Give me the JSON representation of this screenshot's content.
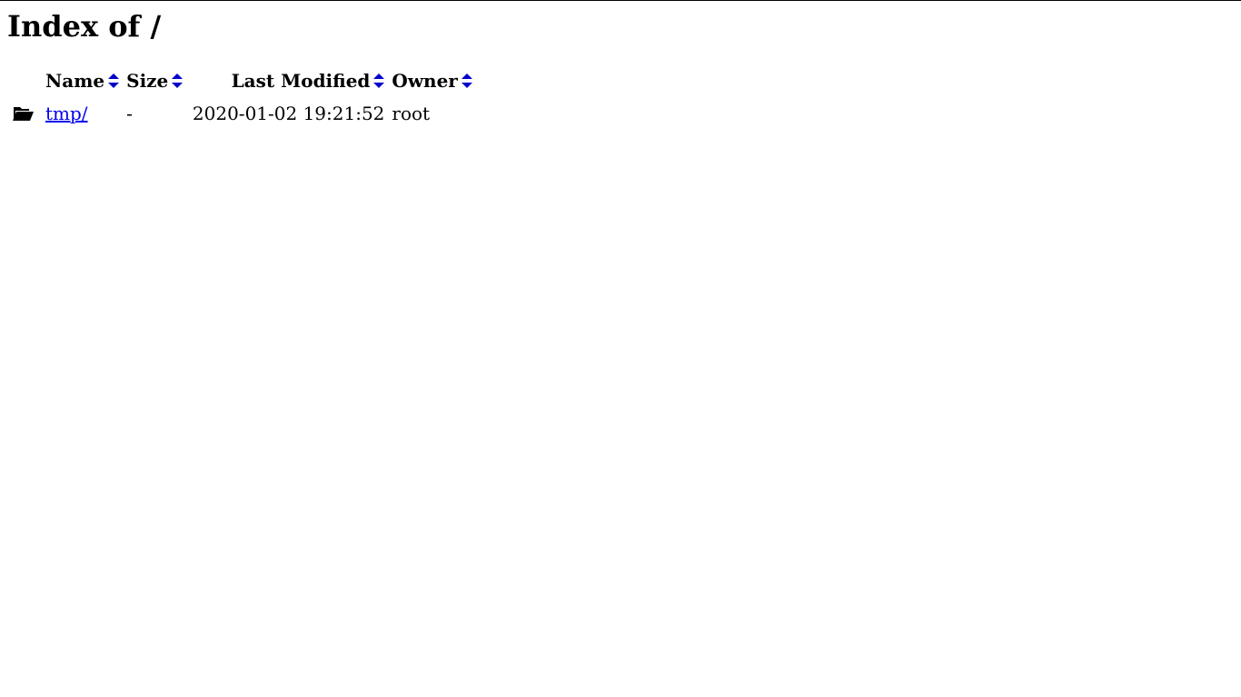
{
  "page": {
    "title": "Index of /"
  },
  "table": {
    "headers": {
      "name": "Name",
      "size": "Size",
      "last_modified": "Last Modified",
      "owner": "Owner"
    },
    "rows": [
      {
        "icon": "folder-open-icon",
        "name": "tmp/",
        "size": "-",
        "last_modified": "2020-01-02 19:21:52",
        "owner": "root"
      }
    ]
  },
  "colors": {
    "link": "#0000ee",
    "sort_arrow": "#0000cc",
    "text": "#000000",
    "background": "#ffffff"
  }
}
